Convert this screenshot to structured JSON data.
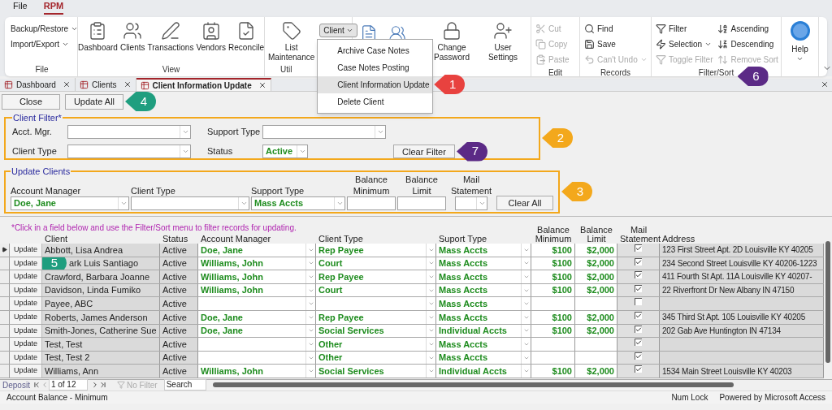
{
  "menu_bar": [
    {
      "label": "File",
      "selected": false
    },
    {
      "label": "RPM",
      "selected": true
    }
  ],
  "ribbon": {
    "groups": [
      {
        "label": "File",
        "items": [
          {
            "kind": "small",
            "label": "Backup/Restore",
            "dropdown": true,
            "disabled": false
          },
          {
            "kind": "small",
            "label": "Import/Export",
            "dropdown": true,
            "disabled": false
          }
        ]
      },
      {
        "label": "View",
        "items": [
          {
            "kind": "large",
            "label": "Dashboard"
          },
          {
            "kind": "large",
            "label": "Clients"
          },
          {
            "kind": "large",
            "label": "Transactions"
          },
          {
            "kind": "large",
            "label": "Vendors"
          },
          {
            "kind": "large",
            "label": "Reconcile"
          }
        ]
      },
      {
        "label": "Util",
        "items": [
          {
            "kind": "large",
            "label": "List Maintenance"
          },
          {
            "kind": "menu-button",
            "label": "Client",
            "dropdown": true
          }
        ]
      },
      {
        "items": [
          {
            "kind": "icon"
          },
          {
            "kind": "icon"
          },
          {
            "kind": "large",
            "label": "Change Password"
          },
          {
            "kind": "large",
            "label": "User Settings"
          }
        ]
      },
      {
        "label": "Edit",
        "items": [
          {
            "kind": "small",
            "label": "Cut",
            "dropdown": false,
            "disabled": true
          },
          {
            "kind": "small",
            "label": "Copy",
            "dropdown": false,
            "disabled": true
          },
          {
            "kind": "small",
            "label": "Paste",
            "dropdown": false,
            "disabled": true
          }
        ]
      },
      {
        "label": "Records",
        "items": [
          {
            "kind": "small",
            "label": "Find",
            "dropdown": false,
            "disabled": false
          },
          {
            "kind": "small",
            "label": "Save",
            "dropdown": false,
            "disabled": false
          },
          {
            "kind": "small",
            "label": "Can't Undo",
            "dropdown": true,
            "disabled": true
          }
        ]
      },
      {
        "label": "Filter/Sort",
        "callout": {
          "number": "6",
          "color": "#5b2a86"
        },
        "items": [
          {
            "kind": "small",
            "label": "Filter",
            "dropdown": false,
            "disabled": false
          },
          {
            "kind": "small",
            "label": "Selection",
            "dropdown": true,
            "disabled": false
          },
          {
            "kind": "small",
            "label": "Toggle Filter",
            "dropdown": false,
            "disabled": true
          },
          {
            "kind": "small",
            "label": "Ascending",
            "dropdown": false,
            "disabled": false
          },
          {
            "kind": "small",
            "label": "Descending",
            "dropdown": false,
            "disabled": false
          },
          {
            "kind": "small",
            "label": "Remove Sort",
            "dropdown": false,
            "disabled": true
          }
        ]
      },
      {
        "items": [
          {
            "kind": "help",
            "label": "Help",
            "dropdown": true
          }
        ]
      }
    ]
  },
  "client_menu": {
    "items": [
      {
        "label": "Archive Case Notes",
        "selected": false
      },
      {
        "label": "Case Notes Posting",
        "selected": false
      },
      {
        "label": "Client Information Update",
        "selected": true,
        "callout": {
          "number": "1",
          "color": "#e8423f"
        }
      },
      {
        "label": "Delete Client",
        "selected": false
      }
    ]
  },
  "tabs": [
    {
      "label": "Dashboard",
      "selected": false
    },
    {
      "label": "Clients",
      "selected": false
    },
    {
      "label": "Client Information Update",
      "selected": true
    }
  ],
  "toolbar": [
    {
      "label": "Close"
    },
    {
      "label": "Update All",
      "callout": {
        "number": "4",
        "color": "#1f9e7f"
      }
    }
  ],
  "client_filter": {
    "title": "Client Filter*",
    "callout": {
      "number": "2",
      "color": "#f3a81c"
    },
    "fields": [
      {
        "label": "Acct. Mgr."
      },
      {
        "label": "Support Type"
      },
      {
        "label": "Client Type"
      },
      {
        "label": "Status",
        "value": "Active"
      }
    ],
    "button": {
      "label": "Clear Filter",
      "callout": {
        "number": "7",
        "color": "#5b2a86"
      }
    }
  },
  "update_clients": {
    "title": "Update Clients",
    "callout": {
      "number": "3",
      "color": "#f3a81c"
    },
    "fields": [
      {
        "label": "Account Manager",
        "kind": "combo",
        "value": "Doe, Jane"
      },
      {
        "label": "Client Type",
        "kind": "combo"
      },
      {
        "label": "Support Type",
        "kind": "combo",
        "value": "Mass Accts"
      },
      {
        "label": "Balance Minimum",
        "kind": "text"
      },
      {
        "label": "Balance Limit",
        "kind": "text"
      },
      {
        "label": "Mail Statement",
        "kind": "combo"
      }
    ],
    "button": {
      "label": "Clear All"
    }
  },
  "hint": "*Click in a field below and use the Filter/Sort menu to filter records for updating.",
  "table": {
    "columns": [
      "Client",
      "Status",
      "Account Manager",
      "Client Type",
      "Suport Type",
      "Balance Minimum",
      "Balance Limit",
      "Mail Statement",
      "Address"
    ],
    "rows": [
      {
        "selected": true,
        "button": "Update",
        "client": "Abbott, Lisa Andrea",
        "status": "Active",
        "account_manager": "Doe, Jane",
        "client_type": "Rep Payee",
        "support_type": "Mass Accts",
        "balance_minimum": "$100",
        "balance_limit": "$2,000",
        "mail_statement": true,
        "address": "123 First Street Apt. 2D Louisville KY 40205"
      },
      {
        "selected": false,
        "button": "Update",
        "callout": {
          "number": "5",
          "color": "#1f9e7f"
        },
        "client": "ark Luis Santiago",
        "status": "Active",
        "account_manager": "Williams, John",
        "client_type": "Court",
        "support_type": "Mass Accts",
        "balance_minimum": "$100",
        "balance_limit": "$2,000",
        "mail_statement": true,
        "address": "234 Second Street Louisville KY 40206-1223"
      },
      {
        "selected": false,
        "button": "Update",
        "client": "Crawford, Barbara Joanne",
        "status": "Active",
        "account_manager": "Williams, John",
        "client_type": "Rep Payee",
        "support_type": "Mass Accts",
        "balance_minimum": "$100",
        "balance_limit": "$2,000",
        "mail_statement": true,
        "address": "411 Fourth St Apt. 11A Louisville KY 40207-"
      },
      {
        "selected": false,
        "button": "Update",
        "client": "Davidson, Linda Fumiko",
        "status": "Active",
        "account_manager": "Williams, John",
        "client_type": "Court",
        "support_type": "Mass Accts",
        "balance_minimum": "$100",
        "balance_limit": "$2,000",
        "mail_statement": true,
        "address": "22 Riverfront Dr New Albany IN 47150"
      },
      {
        "selected": false,
        "button": "Update",
        "client": "Payee, ABC",
        "status": "Active",
        "support_type": "Mass Accts",
        "mail_statement": false
      },
      {
        "selected": false,
        "button": "Update",
        "client": "Roberts, James Anderson",
        "status": "Active",
        "account_manager": "Doe, Jane",
        "client_type": "Rep Payee",
        "support_type": "Mass Accts",
        "balance_minimum": "$100",
        "balance_limit": "$2,000",
        "mail_statement": true,
        "address": "345 Third St Apt. 105 Louisville KY 40205"
      },
      {
        "selected": false,
        "button": "Update",
        "client": "Smith-Jones, Catherine Sue",
        "status": "Active",
        "account_manager": "Doe, Jane",
        "client_type": "Social Services",
        "support_type": "Individual Accts",
        "balance_minimum": "$100",
        "balance_limit": "$2,000",
        "mail_statement": true,
        "address": "202 Gab Ave Huntington IN 47134"
      },
      {
        "selected": false,
        "button": "Update",
        "client": "Test, Test",
        "status": "Active",
        "client_type": "Other",
        "support_type": "Mass Accts",
        "mail_statement": true
      },
      {
        "selected": false,
        "button": "Update",
        "client": "Test, Test 2",
        "status": "Active",
        "client_type": "Other",
        "support_type": "Mass Accts",
        "mail_statement": true
      },
      {
        "selected": false,
        "button": "Update",
        "client": "Williams, Ann",
        "status": "Active",
        "account_manager": "Williams, John",
        "client_type": "Social Services",
        "support_type": "Individual Accts",
        "balance_minimum": "$100",
        "balance_limit": "$2,000",
        "mail_statement": true,
        "address": "1534 Main Street Louisville KY 40203"
      }
    ]
  },
  "navigation": {
    "label": "Deposit",
    "position": "1 of 12",
    "filter": "No Filter",
    "search": "Search"
  },
  "status_bar": {
    "left": "Account Balance - Minimum",
    "right": [
      "Num Lock",
      "Powered by Microsoft Access"
    ]
  }
}
